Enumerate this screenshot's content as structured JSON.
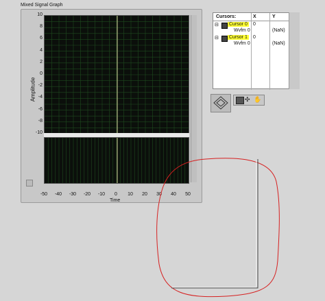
{
  "graph": {
    "title": "Mixed Signal Graph",
    "ylabel": "Amplitude",
    "xlabel": "Time",
    "y_ticks": [
      "10",
      "8",
      "6",
      "4",
      "2",
      "0",
      "-2",
      "-4",
      "-6",
      "-8",
      "-10"
    ],
    "x_ticks": [
      "-50",
      "-40",
      "-30",
      "-20",
      "-10",
      "0",
      "10",
      "20",
      "30",
      "40",
      "50"
    ]
  },
  "cursors": {
    "headers": [
      "Cursors:",
      "X",
      "Y"
    ],
    "rows": [
      {
        "name": "Cursor 0",
        "x": "0",
        "y": "",
        "sub_name": "Wvfm 0",
        "sub_x": "",
        "sub_y": "(NaN)"
      },
      {
        "name": "Cursor 1",
        "x": "0",
        "y": "",
        "sub_name": "Wvfm 0",
        "sub_x": "",
        "sub_y": "(NaN)"
      }
    ]
  },
  "colors": {
    "plot_bg": "#0b0f0b",
    "grid": "#1f4a1f",
    "cursor_highlight": "#ffff33",
    "annotation": "#d62020"
  },
  "icons": [
    "pan-icon",
    "zoom-icon",
    "cursor-tool-icon",
    "hand-tool-icon",
    "expand-minus-icon"
  ]
}
